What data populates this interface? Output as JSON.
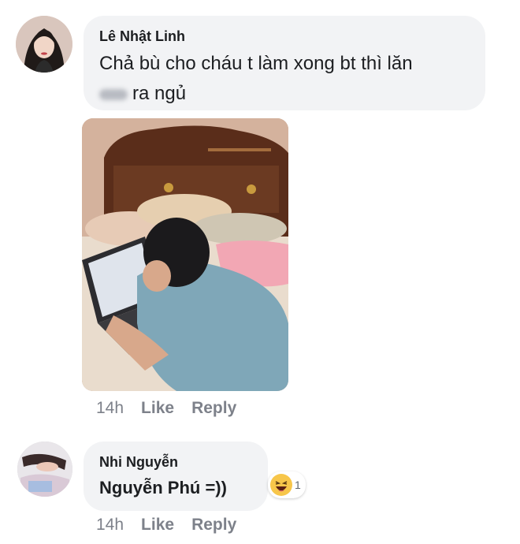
{
  "comments": [
    {
      "author": "Lê Nhật Linh",
      "text_line1": "Chả bù cho cháu t làm xong bt thì lăn",
      "text_line2": "ra ngủ",
      "time": "14h",
      "like_label": "Like",
      "reply_label": "Reply"
    },
    {
      "author": "Nhi Nguyễn",
      "text": "Nguyễn Phú =))",
      "reaction_count": "1",
      "reaction_icon": "laughing-emoji-icon",
      "time": "14h",
      "like_label": "Like",
      "reply_label": "Reply"
    }
  ],
  "colors": {
    "bubble": "#f2f3f5",
    "meta_text": "#7d818a",
    "reaction_yellow": "#f7c64a"
  }
}
